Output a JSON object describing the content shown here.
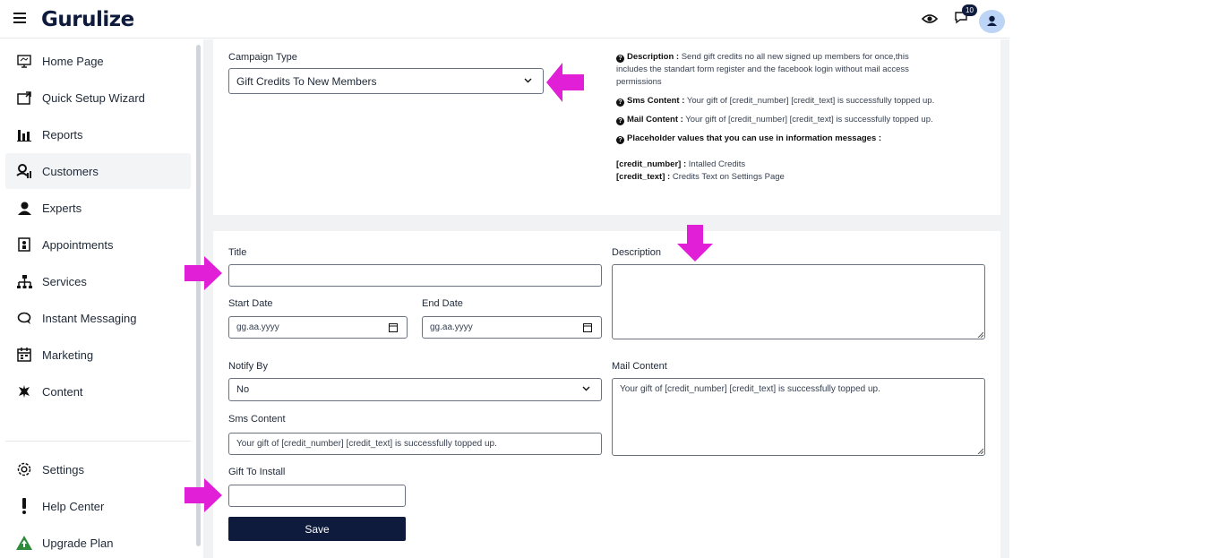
{
  "header": {
    "logo": "Gurulize",
    "notification_count": "10"
  },
  "sidebar": {
    "items": [
      {
        "label": "Home Page",
        "icon": "monitor-icon"
      },
      {
        "label": "Quick Setup Wizard",
        "icon": "wizard-icon"
      },
      {
        "label": "Reports",
        "icon": "bar-chart-icon"
      },
      {
        "label": "Customers",
        "icon": "customers-icon"
      },
      {
        "label": "Experts",
        "icon": "user-icon"
      },
      {
        "label": "Appointments",
        "icon": "appointment-icon"
      },
      {
        "label": "Services",
        "icon": "sitemap-icon"
      },
      {
        "label": "Instant Messaging",
        "icon": "message-icon"
      },
      {
        "label": "Marketing",
        "icon": "calendar-icon"
      },
      {
        "label": "Content",
        "icon": "content-icon"
      }
    ],
    "bottom_items": [
      {
        "label": "Settings",
        "icon": "gear-icon"
      },
      {
        "label": "Help Center",
        "icon": "exclamation-icon"
      },
      {
        "label": "Upgrade Plan",
        "icon": "upgrade-icon"
      }
    ]
  },
  "campaign": {
    "type_label": "Campaign Type",
    "type_value": "Gift Credits To New Members",
    "description_title": "Description :",
    "description_text": "Send gift credits no all new signed up members for once,this",
    "description_text2": "includes the standart form register and the facebook login without mail access",
    "description_text3": "permissions",
    "sms_title": "Sms Content :",
    "sms_text": "Your gift of [credit_number] [credit_text] is successfully topped up.",
    "mail_title": "Mail Content :",
    "mail_text": "Your gift of [credit_number] [credit_text] is successfully topped up.",
    "placeholder_title": "Placeholder values that you can use in information messages :",
    "ph1_key": "[credit_number] :",
    "ph1_val": "Intalled Credits",
    "ph2_key": "[credit_text] :",
    "ph2_val": "Credits Text on Settings Page"
  },
  "form": {
    "title_label": "Title",
    "title_value": "",
    "description_label": "Description",
    "description_value": "",
    "start_date_label": "Start Date",
    "start_date_placeholder": "gg.aa.yyyy",
    "end_date_label": "End Date",
    "end_date_placeholder": "gg.aa.yyyy",
    "notify_by_label": "Notify By",
    "notify_by_value": "No",
    "mail_content_label": "Mail Content",
    "mail_content_value": "Your gift of [credit_number] [credit_text] is successfully topped up.",
    "sms_content_label": "Sms Content",
    "sms_content_value": "Your gift of [credit_number] [credit_text] is successfully topped up.",
    "gift_label": "Gift To Install",
    "gift_value": "",
    "save_label": "Save"
  },
  "colors": {
    "brand_navy": "#0f1b3d",
    "arrow_magenta": "#e01fd6",
    "avatar_bg": "#bcd4f5"
  }
}
